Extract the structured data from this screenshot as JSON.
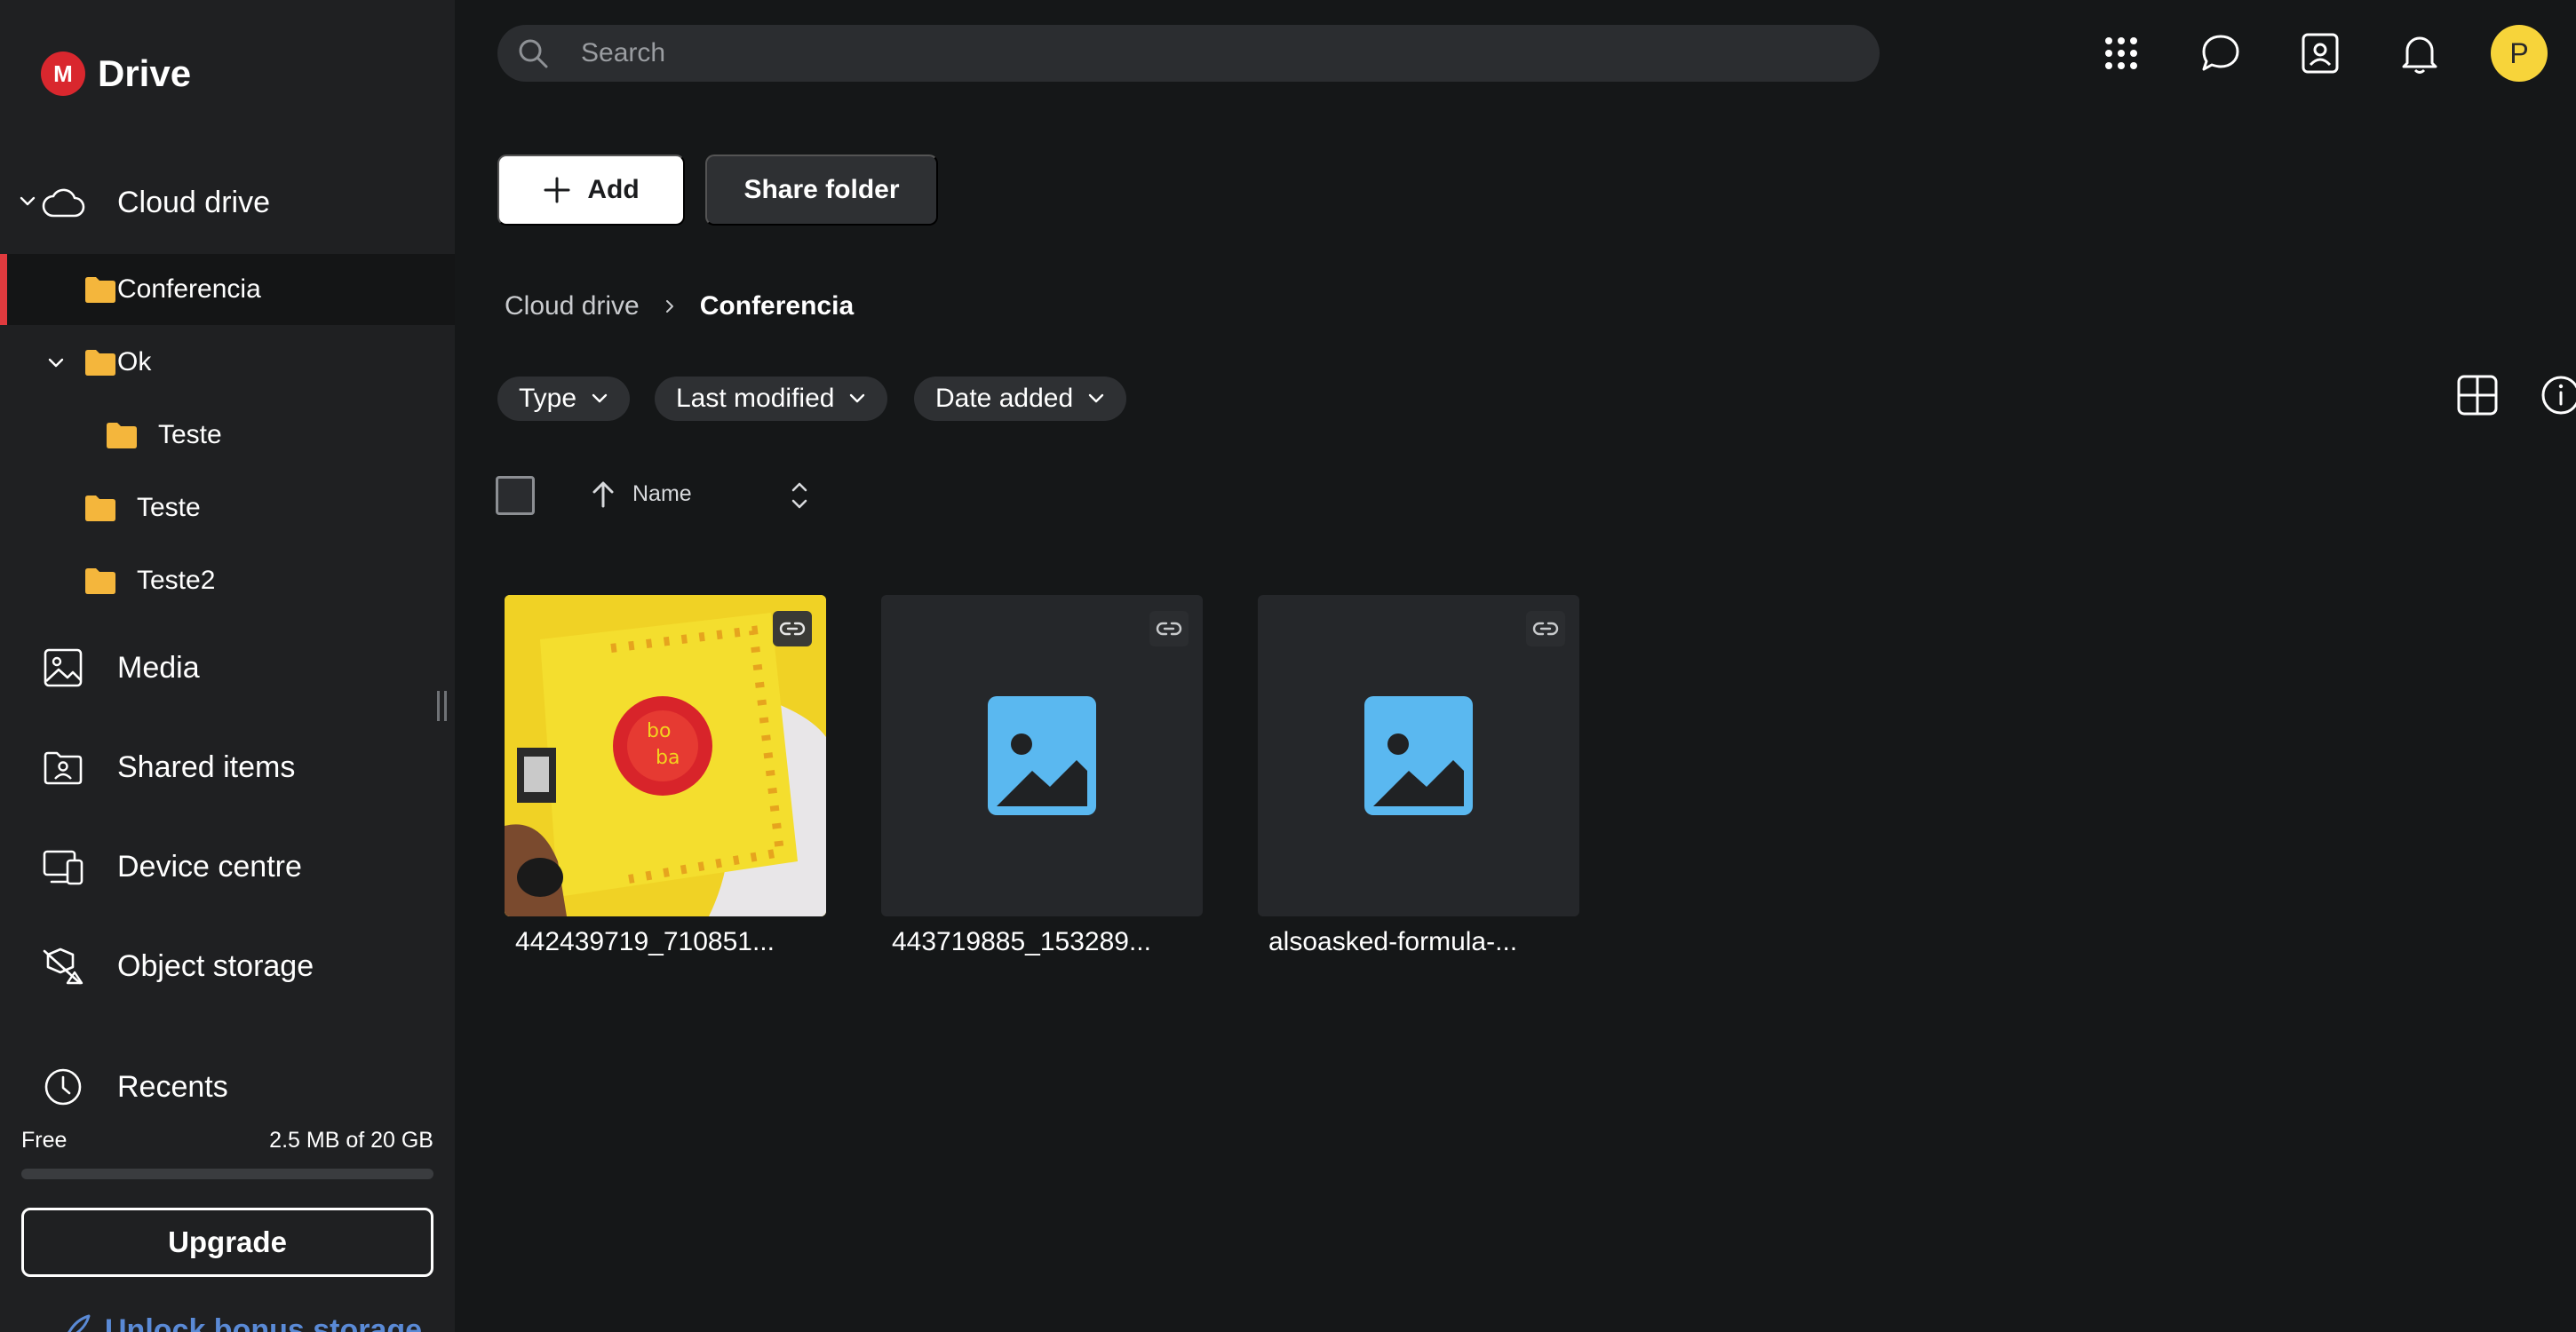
{
  "app": {
    "brand_letter": "M",
    "brand_name": "Drive"
  },
  "sidebar": {
    "cloud_drive_label": "Cloud drive",
    "folders": [
      {
        "label": "Conferencia",
        "selected": true
      },
      {
        "label": "Ok",
        "expanded": true
      },
      {
        "label": "Teste",
        "child_of": "Ok"
      },
      {
        "label": "Teste"
      },
      {
        "label": "Teste2"
      }
    ],
    "nav": [
      {
        "label": "Media",
        "icon": "image-icon"
      },
      {
        "label": "Shared items",
        "icon": "shared-folder-icon"
      },
      {
        "label": "Device centre",
        "icon": "devices-icon"
      },
      {
        "label": "Object storage",
        "icon": "object-storage-icon"
      },
      {
        "label": "Recents",
        "icon": "clock-icon"
      }
    ],
    "storage": {
      "free_label": "Free",
      "used_text": "2.5 MB of 20 GB",
      "used_fraction": 0.000125
    },
    "upgrade_label": "Upgrade",
    "bonus_label": "Unlock bonus storage"
  },
  "topbar": {
    "search_placeholder": "Search",
    "avatar_initial": "P",
    "icons": [
      "apps-grid-icon",
      "chat-icon",
      "contacts-icon",
      "bell-icon"
    ]
  },
  "actions": {
    "add_label": "Add",
    "share_folder_label": "Share folder"
  },
  "breadcrumb": {
    "root": "Cloud drive",
    "current": "Conferencia"
  },
  "filters": {
    "type_label": "Type",
    "last_modified_label": "Last modified",
    "date_added_label": "Date added"
  },
  "list_header": {
    "name_label": "Name"
  },
  "files": [
    {
      "name": "442439719_710851...",
      "kind": "photo"
    },
    {
      "name": "443719885_153289...",
      "kind": "image-placeholder"
    },
    {
      "name": "alsoasked-formula-...",
      "kind": "image-placeholder"
    }
  ],
  "colors": {
    "accent": "#e03a3e",
    "avatar": "#f7d43a",
    "folder": "#f4b63c",
    "image_icon": "#5ab8f0",
    "sidebar_bg": "#1f2022",
    "main_bg": "#151718"
  }
}
